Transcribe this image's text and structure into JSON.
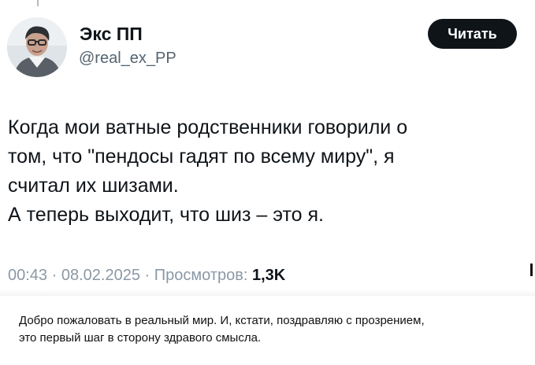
{
  "tweet": {
    "author": {
      "display_name": "Экс ПП",
      "handle": "@real_ex_PP"
    },
    "follow_button_label": "Читать",
    "text_lines": [
      "Когда мои ватные родственники говорили о",
      "том, что \"пендосы гадят по всему миру\", я",
      "считал их шизами.",
      "А теперь выходит, что шиз – это я."
    ],
    "meta": {
      "time": "00:43",
      "separator": "·",
      "date": "08.02.2025",
      "views_label": "Просмотров:",
      "views_count": "1,3K"
    },
    "icons": {
      "avatar": "profile-photo-avatar"
    }
  },
  "caption": {
    "lines": [
      "Добро пожаловать в реальный мир. И, кстати, поздравляю с прозрением,",
      "это первый шаг в сторону здравого смысла."
    ]
  },
  "colors": {
    "text_primary": "#0f1419",
    "text_secondary": "#536471",
    "button_background": "#0f1419",
    "button_text": "#ffffff"
  }
}
